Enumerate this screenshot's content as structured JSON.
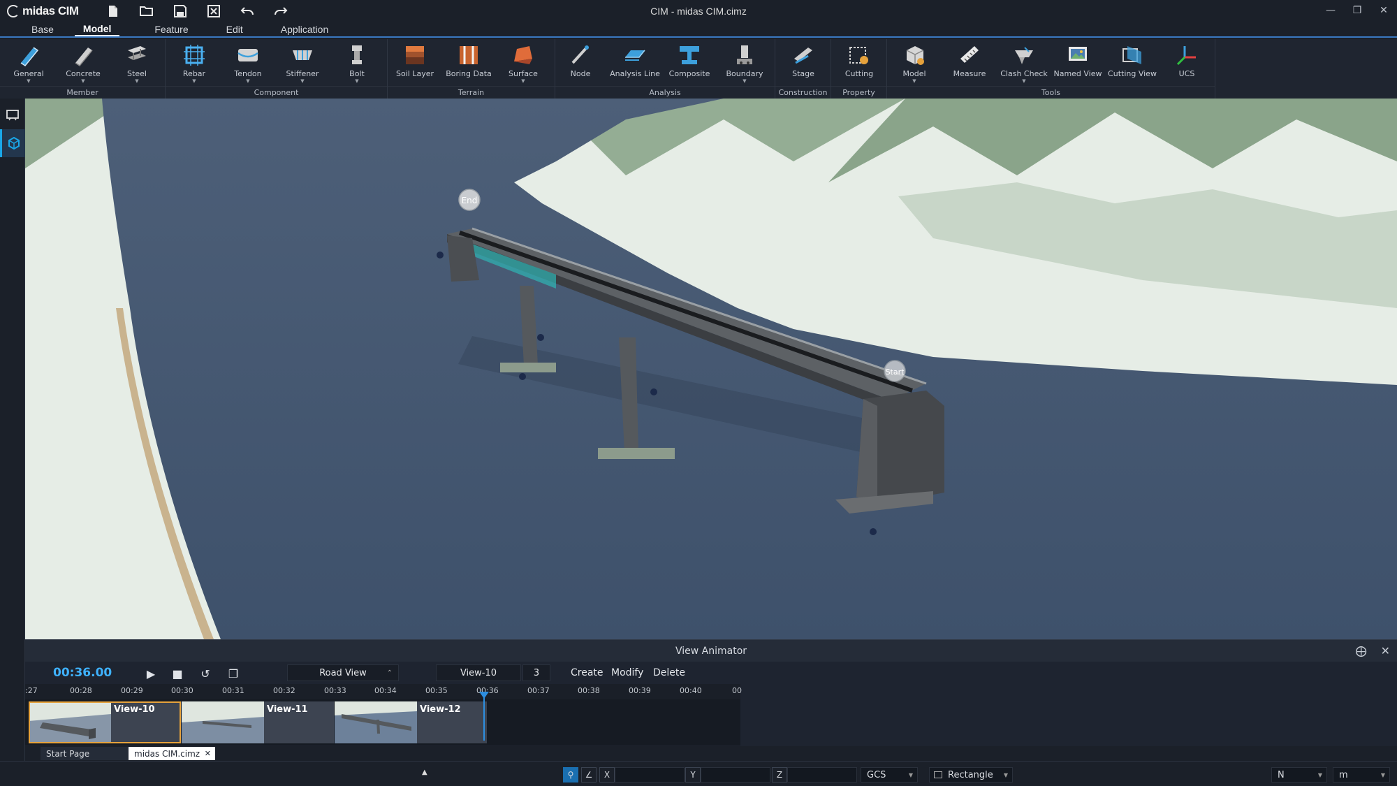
{
  "app": {
    "logo_text": "midas CIM",
    "window_title": "CIM - midas CIM.cimz",
    "quick_access": [
      "new-icon",
      "open-icon",
      "save-icon",
      "close-file-icon",
      "undo-icon",
      "redo-icon"
    ]
  },
  "tabs": [
    "Base",
    "Model",
    "Feature",
    "Edit",
    "Application"
  ],
  "active_tab": "Model",
  "ribbon": {
    "groups": [
      {
        "name": "Member",
        "buttons": [
          "General",
          "Concrete",
          "Steel"
        ]
      },
      {
        "name": "Component",
        "buttons": [
          "Rebar",
          "Tendon",
          "Stiffener",
          "Bolt"
        ]
      },
      {
        "name": "Terrain",
        "buttons": [
          "Soil Layer",
          "Boring Data",
          "Surface"
        ]
      },
      {
        "name": "Analysis",
        "buttons": [
          "Node",
          "Analysis Line",
          "Composite",
          "Boundary"
        ]
      },
      {
        "name": "Construction",
        "buttons": [
          "Stage"
        ]
      },
      {
        "name": "Property",
        "buttons": [
          "Cutting"
        ]
      },
      {
        "name": "Tools",
        "buttons": [
          "Model",
          "Measure",
          "Clash Check",
          "Named View",
          "Cutting View",
          "UCS"
        ]
      }
    ]
  },
  "viewport": {
    "markers": [
      "End",
      "Start"
    ]
  },
  "animator": {
    "title": "View Animator",
    "time": "00:36.00",
    "view_mode": "Road View",
    "current_view": "View-10",
    "count": "3",
    "actions": [
      "Create",
      "Modify",
      "Delete"
    ],
    "ticks": [
      ":27",
      "00:28",
      "00:29",
      "00:30",
      "00:31",
      "00:32",
      "00:33",
      "00:34",
      "00:35",
      "00:36",
      "00:37",
      "00:38",
      "00:39",
      "00:40",
      "00"
    ],
    "keyframes": [
      "View-10",
      "View-11",
      "View-12"
    ],
    "selected_keyframe": "View-10"
  },
  "doc_tabs": [
    "Start Page",
    "midas CIM.cimz"
  ],
  "active_doc": "midas CIM.cimz",
  "status": {
    "x_label": "X",
    "y_label": "Y",
    "z_label": "Z",
    "coord_system": "GCS",
    "selection_mode": "Rectangle",
    "force_unit": "N",
    "length_unit": "m"
  },
  "colors": {
    "accent": "#3a78c0",
    "time_text": "#3fb2ff",
    "selected_keyframe": "#e6a23c"
  }
}
